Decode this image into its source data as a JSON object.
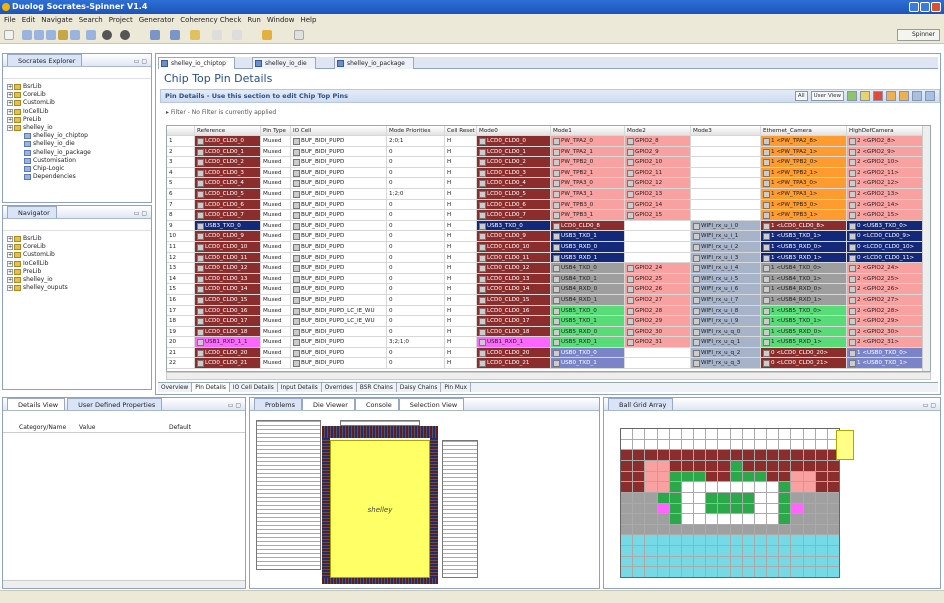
{
  "window": {
    "title": "Duolog Socrates-Spinner V1.4"
  },
  "menu": [
    "File",
    "Edit",
    "Navigate",
    "Search",
    "Project",
    "Generator",
    "Coherency Check",
    "Run",
    "Window",
    "Help"
  ],
  "toolbar": {
    "perspective_label": "Spinner"
  },
  "explorer": {
    "tab": "Socrates Explorer",
    "items": [
      {
        "label": "BsrLib",
        "level": 1
      },
      {
        "label": "CoreLib",
        "level": 1
      },
      {
        "label": "CustomLib",
        "level": 1
      },
      {
        "label": "IoCellLib",
        "level": 1
      },
      {
        "label": "PreLib",
        "level": 1
      },
      {
        "label": "shelley_io",
        "level": 1
      },
      {
        "label": "shelley_io_chiptop",
        "level": 2
      },
      {
        "label": "shelley_io_die",
        "level": 2
      },
      {
        "label": "shelley_io_package",
        "level": 2
      },
      {
        "label": "Customisation",
        "level": 2
      },
      {
        "label": "Chip-Logic",
        "level": 2
      },
      {
        "label": "Dependencies",
        "level": 2
      }
    ]
  },
  "navigator": {
    "tab": "Navigator",
    "items": [
      "BsrLib",
      "CoreLib",
      "CustomLib",
      "IoCellLib",
      "PreLib",
      "shelley_io",
      "shelley_ouputs"
    ]
  },
  "editor": {
    "tabs": [
      "shelley_io_chiptop",
      "shelley_io_die",
      "shelley_io_package"
    ],
    "title": "Chip Top Pin Details",
    "section_title": "Pin Details - Use this section to edit Chip Top Pins",
    "filter": "Filter - No Filter is currently applied",
    "buttons": {
      "all": "All",
      "user_view": "User View"
    },
    "columns": [
      "",
      "Reference",
      "Pin Type",
      "IO Cell",
      "Mode Priorities",
      "Cell Reset",
      "Mode0",
      "Mode1",
      "Mode2",
      "Mode3",
      "Ethernet_Camera",
      "HighDefCamera"
    ],
    "rows": [
      [
        "1",
        "LCD0_CLD0_0",
        "Muxed",
        "BUF_BIDI_PUPD",
        "2;0;1",
        "H",
        "LCD0_CLD0_0",
        "PW_TPA2_0",
        "GPIO2_8",
        "",
        "1 <PW_TPA2_8>",
        "2 <GPIO2_8>"
      ],
      [
        "2",
        "LCD0_CLD0_1",
        "Muxed",
        "BUF_BIDI_PUPD",
        "0",
        "H",
        "LCD0_CLD0_1",
        "PW_TPA2_1",
        "GPIO2_9",
        "",
        "1 <PW_TPA2_1>",
        "2 <GPIO2_9>"
      ],
      [
        "3",
        "LCD0_CLD0_2",
        "Muxed",
        "BUF_BIDI_PUPD",
        "0",
        "H",
        "LCD0_CLD0_2",
        "PW_TPB2_0",
        "GPIO2_10",
        "",
        "1 <PW_TPB2_0>",
        "2 <GPIO2_10>"
      ],
      [
        "4",
        "LCD0_CLD0_3",
        "Muxed",
        "BUF_BIDI_PUPD",
        "0",
        "H",
        "LCD0_CLD0_3",
        "PW_TPB2_1",
        "GPIO2_11",
        "",
        "1 <PW_TPB2_1>",
        "2 <GPIO2_11>"
      ],
      [
        "5",
        "LCD0_CLD0_4",
        "Muxed",
        "BUF_BIDI_PUPD",
        "0",
        "H",
        "LCD0_CLD0_4",
        "PW_TPA3_0",
        "GPIO2_12",
        "",
        "1 <PW_TPA3_0>",
        "2 <GPIO2_12>"
      ],
      [
        "6",
        "LCD0_CLD0_5",
        "Muxed",
        "BUF_BIDI_PUPD",
        "1;2;0",
        "H",
        "LCD0_CLD0_5",
        "PW_TPA3_1",
        "GPIO2_13",
        "",
        "1 <PW_TPA3_1>",
        "2 <GPIO2_13>"
      ],
      [
        "7",
        "LCD0_CLD0_6",
        "Muxed",
        "BUF_BIDI_PUPD",
        "0",
        "H",
        "LCD0_CLD0_6",
        "PW_TPB3_0",
        "GPIO2_14",
        "",
        "1 <PW_TPB3_0>",
        "2 <GPIO2_14>"
      ],
      [
        "8",
        "LCD0_CLD0_7",
        "Muxed",
        "BUF_BIDI_PUPD",
        "0",
        "H",
        "LCD0_CLD0_7",
        "PW_TPB3_1",
        "GPIO2_15",
        "",
        "1 <PW_TPB3_1>",
        "2 <GPIO2_15>"
      ],
      [
        "9",
        "USB3_TXD_0",
        "Muxed",
        "BUF_BIDI_PUPD",
        "0",
        "H",
        "USB3_TXD_0",
        "LCD0_CLD0_8",
        "",
        "WIFI_rx_u_i_0",
        "1 <LCD0_CLD0_8>",
        "0 <USB3_TXD_0>"
      ],
      [
        "10",
        "LCD0_CLD0_9",
        "Muxed",
        "BUF_BIDI_PUPD",
        "0",
        "H",
        "LCD0_CLD0_9",
        "USB3_TXD_1",
        "",
        "WIFI_rx_u_i_1",
        "1 <USB3_TXD_1>",
        "0 <LCD0_CLD0_9>"
      ],
      [
        "11",
        "LCD0_CLD0_10",
        "Muxed",
        "BUF_BIDI_PUPD",
        "0",
        "H",
        "LCD0_CLD0_10",
        "USB3_RXD_0",
        "",
        "WIFI_rx_u_i_2",
        "1 <USB3_RXD_0>",
        "0 <LCD0_CLD0_10>"
      ],
      [
        "12",
        "LCD0_CLD0_11",
        "Muxed",
        "BUF_BIDI_PUPD",
        "0",
        "H",
        "LCD0_CLD0_11",
        "USB3_RXD_1",
        "",
        "WIFI_rx_u_i_3",
        "1 <USB3_RXD_1>",
        "0 <LCD0_CLD0_11>"
      ],
      [
        "13",
        "LCD0_CLD0_12",
        "Muxed",
        "BUF_BIDI_PUPD",
        "0",
        "H",
        "LCD0_CLD0_12",
        "USB4_TXD_0",
        "GPIO2_24",
        "WIFI_rx_u_i_4",
        "1 <USB4_TXD_0>",
        "2 <GPIO2_24>"
      ],
      [
        "14",
        "LCD0_CLD0_13",
        "Muxed",
        "BUF_BIDI_PUPD",
        "0",
        "H",
        "LCD0_CLD0_13",
        "USB4_TXD_1",
        "GPIO2_25",
        "WIFI_rx_u_i_5",
        "1 <USB4_TXD_1>",
        "2 <GPIO2_25>"
      ],
      [
        "15",
        "LCD0_CLD0_14",
        "Muxed",
        "BUF_BIDI_PUPD",
        "0",
        "H",
        "LCD0_CLD0_14",
        "USB4_RXD_0",
        "GPIO2_26",
        "WIFI_rx_u_i_6",
        "1 <USB4_RXD_0>",
        "2 <GPIO2_26>"
      ],
      [
        "16",
        "LCD0_CLD0_15",
        "Muxed",
        "BUF_BIDI_PUPD",
        "0",
        "H",
        "LCD0_CLD0_15",
        "USB4_RXD_1",
        "GPIO2_27",
        "WIFI_rx_u_i_7",
        "1 <USB4_RXD_1>",
        "2 <GPIO2_27>"
      ],
      [
        "17",
        "LCD0_CLD0_16",
        "Muxed",
        "BUF_BIDI_PUPD_LC_IE_WU",
        "0",
        "H",
        "LCD0_CLD0_16",
        "USB5_TXD_0",
        "GPIO2_28",
        "WIFI_rx_u_i_8",
        "1 <USB5_TXD_0>",
        "2 <GPIO2_28>"
      ],
      [
        "18",
        "LCD0_CLD0_17",
        "Muxed",
        "BUF_BIDI_PUPD_LC_IE_WU",
        "0",
        "H",
        "LCD0_CLD0_17",
        "USB5_TXD_1",
        "GPIO2_29",
        "WIFI_rx_u_i_9",
        "1 <USB5_TXD_1>",
        "2 <GPIO2_29>"
      ],
      [
        "19",
        "LCD0_CLD0_18",
        "Muxed",
        "BUF_BIDI_PUPD",
        "0",
        "H",
        "LCD0_CLD0_18",
        "USB5_RXD_0",
        "GPIO2_30",
        "WIFI_rx_u_q_0",
        "1 <USB5_RXD_0>",
        "2 <GPIO2_30>"
      ],
      [
        "20",
        "USB1_RXD_1_1",
        "Muxed",
        "BUF_BIDI_PUPD",
        "3;2;1;0",
        "H",
        "USB1_RXD_1",
        "USB5_RXD_1",
        "GPIO2_31",
        "WIFI_rx_u_q_1",
        "1 <USB5_RXD_1>",
        "2 <GPIO2_31>"
      ],
      [
        "21",
        "LCD0_CLD0_20",
        "Muxed",
        "BUF_BIDI_PUPD",
        "0",
        "H",
        "LCD0_CLD0_20",
        "USB0_TXD_0",
        "",
        "WIFI_rx_u_q_2",
        "0 <LCD0_CLD0_20>",
        "1 <USB0_TXD_0>"
      ],
      [
        "22",
        "LCD0_CLD0_21",
        "Muxed",
        "BUF_BIDI_PUPD",
        "0",
        "H",
        "LCD0_CLD0_21",
        "USB0_TXD_1",
        "",
        "WIFI_rx_u_q_3",
        "0 <LCD0_CLD0_21>",
        "1 <USB0_TXD_1>"
      ]
    ],
    "bottom_tabs": [
      "Overview",
      "Pin Details",
      "IO Cell Details",
      "Input Details",
      "Overrides",
      "BSR Chains",
      "Daisy Chains",
      "Pin Mux"
    ]
  },
  "details": {
    "tabs": [
      "Details View",
      "User Defined Properties"
    ],
    "columns": [
      "Category/Name",
      "Value",
      "Default"
    ]
  },
  "center": {
    "tabs": [
      "Problems",
      "Die Viewer",
      "Console",
      "Selection View"
    ],
    "chip_label": "shelley"
  },
  "ballgrid": {
    "tab": "Ball Grid Array"
  },
  "colors": {
    "brown": "#8b2d2d",
    "pink": "#f9a0a0",
    "orange": "#ff9b2f",
    "navy": "#14287a",
    "gray": "#9e9e9e",
    "green": "#58dc78",
    "blue": "#7b84c8",
    "magenta": "#ff66ff",
    "cyan": "#76d9e6",
    "grayblue": "#a6b3c9"
  }
}
